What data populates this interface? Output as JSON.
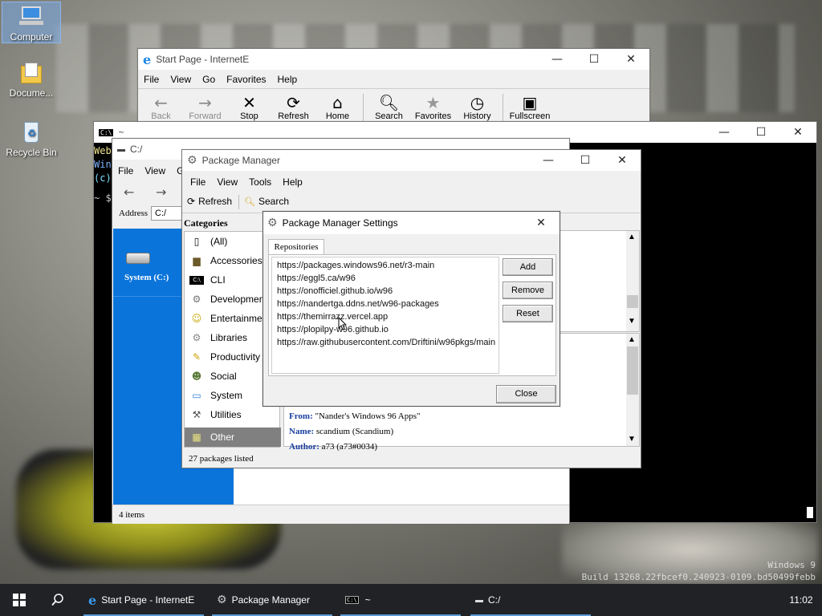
{
  "desktop": {
    "icons": [
      {
        "label": "Computer",
        "icon": "computer-icon"
      },
      {
        "label": "Docume...",
        "icon": "documents-folder-icon"
      },
      {
        "label": "Recycle Bin",
        "icon": "recycle-bin-icon"
      }
    ],
    "watermark_line1": "Windows 9",
    "watermark_line2": "Build 13268.22fbcef0.240923-0109.bd50499febb"
  },
  "ie": {
    "title": "Start Page - InternetE",
    "menu": [
      "File",
      "View",
      "Go",
      "Favorites",
      "Help"
    ],
    "toolbar": [
      {
        "label": "Back",
        "icon": "back-arrow-icon",
        "disabled": true
      },
      {
        "label": "Forward",
        "icon": "forward-arrow-icon",
        "disabled": true
      },
      {
        "label": "Stop",
        "icon": "stop-icon"
      },
      {
        "label": "Refresh",
        "icon": "refresh-icon"
      },
      {
        "label": "Home",
        "icon": "home-icon"
      },
      {
        "label": "Search",
        "icon": "search-icon"
      },
      {
        "label": "Favorites",
        "icon": "favorites-icon"
      },
      {
        "label": "History",
        "icon": "history-icon"
      },
      {
        "label": "Fullscreen",
        "icon": "fullscreen-icon"
      }
    ]
  },
  "terminal": {
    "title": "~",
    "lines": [
      "Web",
      "Win",
      "(c)"
    ],
    "prompt": "~ $"
  },
  "explorer": {
    "title": "C:/",
    "menu": [
      "File",
      "View",
      "G"
    ],
    "address_label": "Address",
    "address_value": "C:/",
    "drive_label": "System (C:)",
    "status": "4 items"
  },
  "pm": {
    "title": "Package Manager",
    "menu": [
      "File",
      "View",
      "Tools",
      "Help"
    ],
    "toolbar": {
      "refresh": "Refresh",
      "search": "Search"
    },
    "categories_header": "Categories",
    "categories": [
      {
        "label": "(All)",
        "icon": "all-icon"
      },
      {
        "label": "Accessories",
        "icon": "accessories-icon"
      },
      {
        "label": "CLI",
        "icon": "cli-icon"
      },
      {
        "label": "Development",
        "icon": "development-icon"
      },
      {
        "label": "Entertainment",
        "icon": "entertainment-icon"
      },
      {
        "label": "Libraries",
        "icon": "libraries-icon"
      },
      {
        "label": "Productivity",
        "icon": "productivity-icon"
      },
      {
        "label": "Social",
        "icon": "social-icon"
      },
      {
        "label": "System",
        "icon": "system-icon"
      },
      {
        "label": "Utilities",
        "icon": "utilities-icon"
      },
      {
        "label": "Other",
        "icon": "other-icon",
        "selected": true
      }
    ],
    "details": [
      {
        "key": "From:",
        "value": "\"Nander's Windows 96 Apps\""
      },
      {
        "key": "Name:",
        "value": "scandium (Scandium)"
      },
      {
        "key": "Author:",
        "value": "a73 (a73#0034)"
      }
    ],
    "status": "27 packages listed"
  },
  "settings": {
    "title": "Package Manager Settings",
    "tab": "Repositories",
    "repos": [
      "https://packages.windows96.net/r3-main",
      "https://eggl5.ca/w96",
      "https://onofficiel.github.io/w96",
      "https://nandertga.ddns.net/w96-packages",
      "https://themirrazz.vercel.app",
      "https://plopilpy-w96.github.io",
      "https://raw.githubusercontent.com/Driftini/w96pkgs/main"
    ],
    "buttons": {
      "add": "Add",
      "remove": "Remove",
      "reset": "Reset",
      "close": "Close"
    }
  },
  "taskbar": {
    "items": [
      {
        "label": "Start Page - InternetE",
        "icon": "ie-icon"
      },
      {
        "label": "Package Manager",
        "icon": "package-manager-icon"
      },
      {
        "label": "~",
        "icon": "terminal-icon"
      },
      {
        "label": "C:/",
        "icon": "drive-icon"
      }
    ],
    "clock": "11:02"
  },
  "colors": {
    "accent": "#0078d7",
    "explorer_side": "#0a74da",
    "taskbar": "#202225",
    "selected": "#808080"
  }
}
